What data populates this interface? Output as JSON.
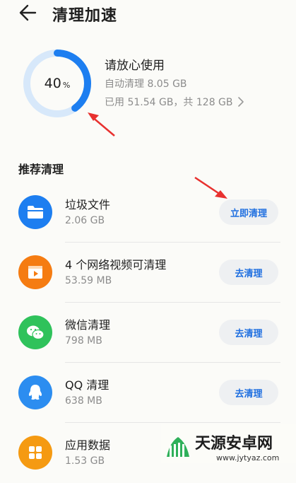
{
  "header": {
    "title": "清理加速"
  },
  "summary": {
    "percent_value": "40",
    "percent_sign": "%",
    "usage_fraction": 0.4,
    "title": "请放心使用",
    "auto_clean": "自动清理 8.05 GB",
    "used": "已用 51.54 GB，共 128 GB"
  },
  "section": {
    "title": "推荐清理"
  },
  "items": [
    {
      "name": "垃圾文件",
      "size": "2.06 GB",
      "button": "立即清理",
      "icon": "folder-icon",
      "color": "#1d7ef0"
    },
    {
      "name": "4 个网络视频可清理",
      "size": "53.59 MB",
      "button": "去清理",
      "icon": "video-icon",
      "color": "#f57c12"
    },
    {
      "name": "微信清理",
      "size": "798 MB",
      "button": "去清理",
      "icon": "wechat-icon",
      "color": "#2fc25b"
    },
    {
      "name": "QQ 清理",
      "size": "638 MB",
      "button": "去清理",
      "icon": "qq-icon",
      "color": "#2c8df0"
    },
    {
      "name": "应用数据",
      "size": "1.53 GB",
      "icon": "apps-icon",
      "color": "#f59a12"
    }
  ],
  "watermark": {
    "name": "天源安卓网",
    "url": "www.jytyaz.com"
  },
  "colors": {
    "accent": "#1f6fe0",
    "ring": "#1d7ef0",
    "ring_track": "#d7e8fa",
    "annotation": "#e8312f"
  }
}
